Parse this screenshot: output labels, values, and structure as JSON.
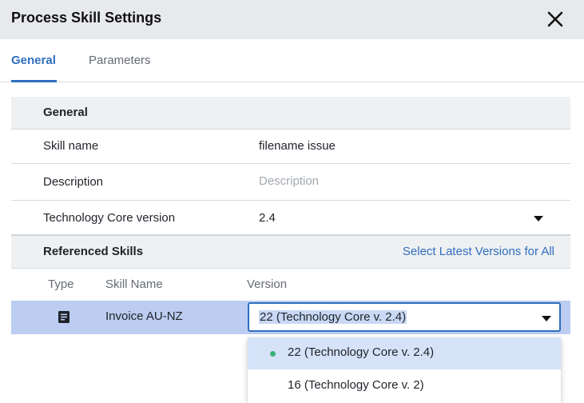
{
  "dialog": {
    "title": "Process Skill Settings",
    "close_icon": "close-icon"
  },
  "tabs": [
    {
      "label": "General",
      "active": true
    },
    {
      "label": "Parameters",
      "active": false
    }
  ],
  "general": {
    "section_title": "General",
    "skill_name": {
      "label": "Skill name",
      "value": "filename issue"
    },
    "description": {
      "label": "Description",
      "placeholder": "Description"
    },
    "tech_core": {
      "label": "Technology Core version",
      "value": "2.4"
    }
  },
  "referenced": {
    "section_title": "Referenced Skills",
    "select_latest": "Select Latest Versions for All",
    "columns": {
      "type": "Type",
      "skill_name": "Skill Name",
      "version": "Version"
    },
    "rows": [
      {
        "type_icon": "document-icon",
        "name": "Invoice AU-NZ",
        "version": "22 (Technology Core v. 2.4)"
      }
    ],
    "version_options": [
      {
        "label": "22 (Technology Core v. 2.4)",
        "selected": true
      },
      {
        "label": "16 (Technology Core v. 2)",
        "selected": false
      }
    ]
  },
  "colors": {
    "accent": "#2f6fc0",
    "selected_row": "#bccdf1",
    "selected_dot": "#3cb07a"
  }
}
